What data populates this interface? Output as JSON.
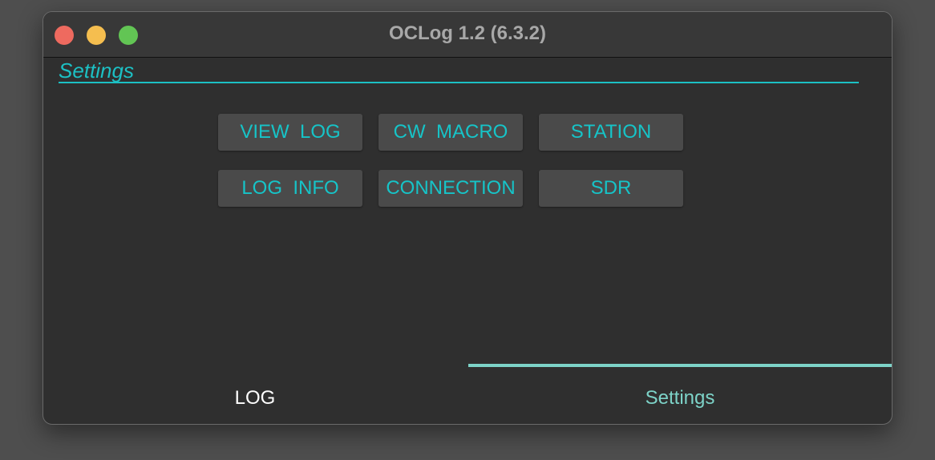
{
  "window": {
    "title": "OCLog 1.2 (6.3.2)"
  },
  "section": {
    "title": "Settings"
  },
  "buttons": {
    "view_log": "VIEW  LOG",
    "cw_macro": "CW  MACRO",
    "station": "STATION",
    "log_info": "LOG  INFO",
    "connection": "CONNECTION",
    "sdr": "SDR"
  },
  "tabs": [
    {
      "label": "LOG",
      "selected": false
    },
    {
      "label": "Settings",
      "selected": true
    }
  ],
  "colors": {
    "accent": "#1cc0c4",
    "tab_accent": "#7dd3c8"
  }
}
